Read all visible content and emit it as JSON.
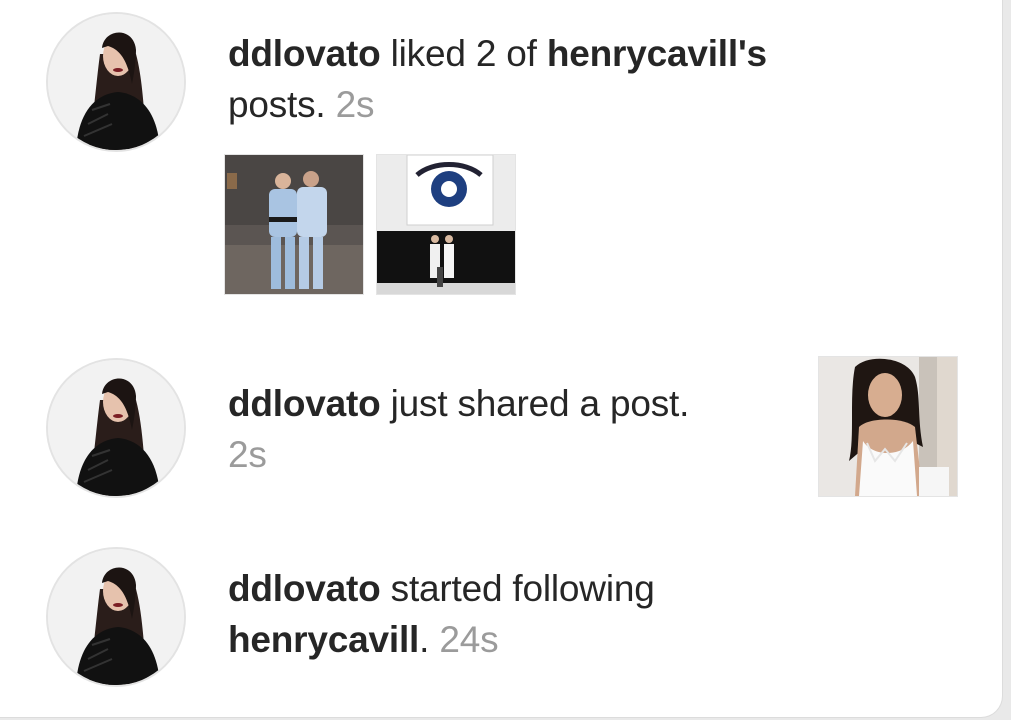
{
  "notifications": [
    {
      "username": "ddlovato",
      "action": " liked 2 of ",
      "target": "henrycavill's",
      "rest": " posts.",
      "time": "2s",
      "avatar": "ddlovato-avatar",
      "thumbnails": [
        "jiu-jitsu-photo-1",
        "jiu-jitsu-photo-2"
      ]
    },
    {
      "username": "ddlovato",
      "action": " just shared a post.",
      "time": "2s",
      "avatar": "ddlovato-avatar",
      "thumbnails": [
        "shared-post-photo"
      ]
    },
    {
      "username": "ddlovato",
      "action": " started following ",
      "target": "henrycavill",
      "rest": ".",
      "time": "24s",
      "avatar": "ddlovato-avatar"
    }
  ],
  "colors": {
    "text": "#262626",
    "timestamp": "#9b9b9b",
    "background": "#ffffff"
  }
}
